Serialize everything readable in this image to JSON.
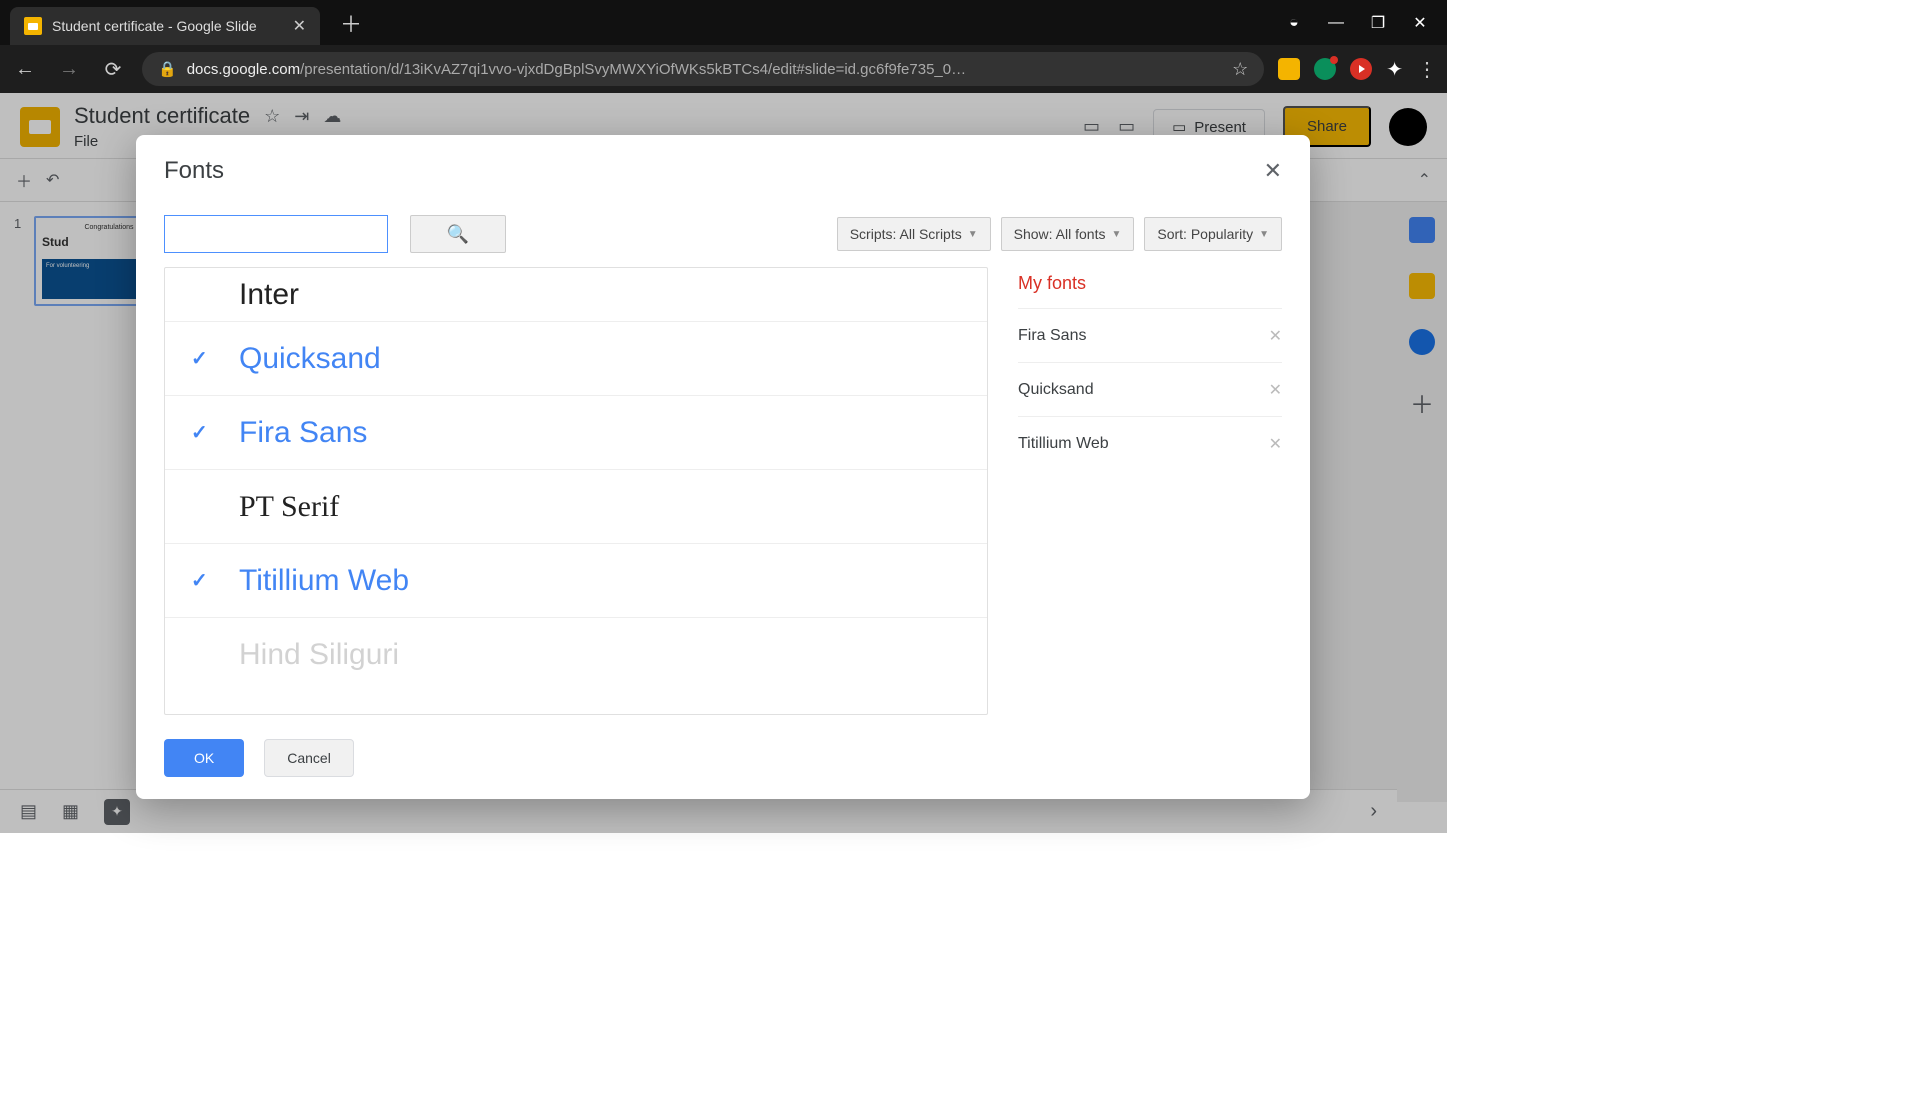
{
  "browser": {
    "tab_title": "Student certificate - Google Slide",
    "url_prefix": "docs.google.com",
    "url_path": "/presentation/d/13iKvAZ7qi1vvo-vjxdDgBplSvyMWXYiOfWKs5kBTCs4/edit#slide=id.gc6f9fe735_0…"
  },
  "app": {
    "doc_title": "Student certificate",
    "menu_file": "File",
    "present_label": "Present",
    "share_label": "Share",
    "thumb_congrats": "Congratulations",
    "thumb_name": "Stud",
    "thumb_line": "For volunteering",
    "slide_number": "1"
  },
  "modal": {
    "title": "Fonts",
    "search_value": "",
    "scripts_label": "Scripts: All Scripts",
    "show_label": "Show: All fonts",
    "sort_label": "Sort: Popularity",
    "ok_label": "OK",
    "cancel_label": "Cancel",
    "myfonts_title": "My fonts",
    "fonts": {
      "f0": "Inter",
      "f1": "Quicksand",
      "f2": "Fira Sans",
      "f3": "PT Serif",
      "f4": "Titillium Web"
    },
    "myfonts": {
      "m0": "Fira Sans",
      "m1": "Quicksand",
      "m2": "Titillium Web"
    }
  }
}
